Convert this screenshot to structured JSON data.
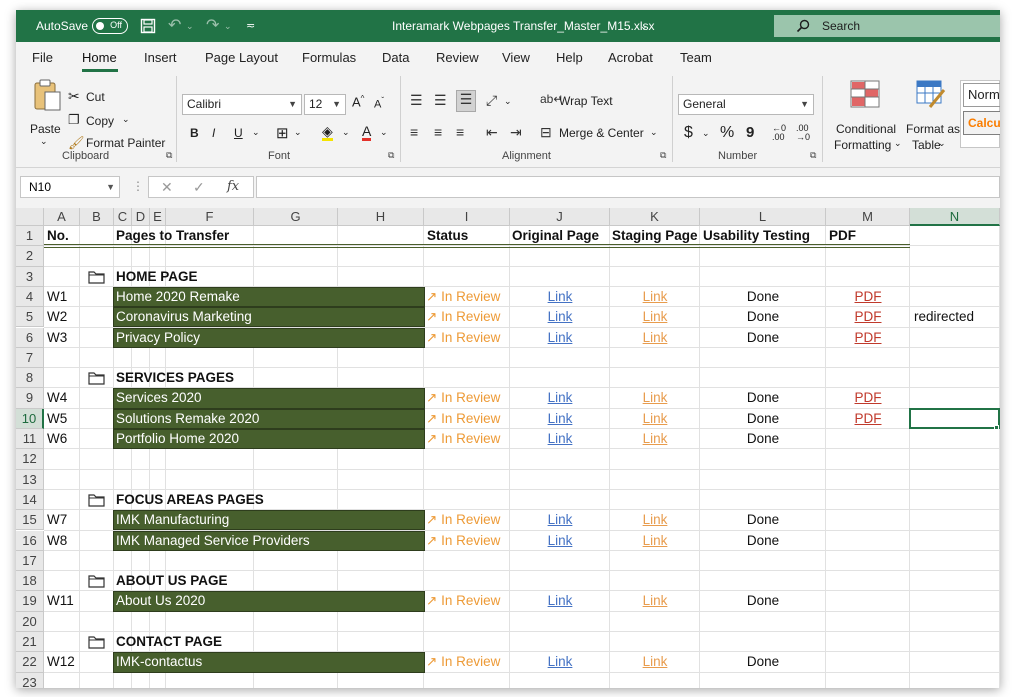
{
  "titlebar": {
    "autosave_label": "AutoSave",
    "autosave_state": "Off",
    "filename": "Interamark Webpages Transfer_Master_M15.xlsx",
    "search_label": "Search"
  },
  "menu": [
    "File",
    "Home",
    "Insert",
    "Page Layout",
    "Formulas",
    "Data",
    "Review",
    "View",
    "Help",
    "Acrobat",
    "Team"
  ],
  "ribbon": {
    "paste": "Paste",
    "cut": "Cut",
    "copy": "Copy",
    "format_painter": "Format Painter",
    "clipboard_group": "Clipboard",
    "font_name": "Calibri",
    "font_size": "12",
    "bold": "B",
    "italic": "I",
    "underline": "U",
    "font_group": "Font",
    "wrap_text": "Wrap Text",
    "merge_center": "Merge & Center",
    "alignment_group": "Alignment",
    "number_format": "General",
    "dollar": "$",
    "percent": "%",
    "comma": "9",
    "number_group": "Number",
    "conditional_formatting_1": "Conditional",
    "conditional_formatting_2": "Formatting",
    "format_as_table_1": "Format as",
    "format_as_table_2": "Table",
    "style_normal": "Norm",
    "style_calc": "Calcu"
  },
  "formula_bar": {
    "name_box": "N10",
    "fx": "fx"
  },
  "columns": [
    "A",
    "B",
    "C",
    "D",
    "E",
    "F",
    "G",
    "H",
    "I",
    "J",
    "K",
    "L",
    "M",
    "N"
  ],
  "selected_column": "N",
  "selected_row": "10",
  "headers": {
    "no": "No.",
    "pages": "Pages to Transfer",
    "status": "Status",
    "original": "Original Page",
    "staging": "Staging Page",
    "usability": "Usability Testing",
    "pdf": "PDF"
  },
  "rows": [
    {
      "row": "1"
    },
    {
      "row": "2"
    },
    {
      "row": "3",
      "section": "HOME PAGE"
    },
    {
      "row": "4",
      "no": "W1",
      "page": "Home 2020 Remake",
      "status": "In Review",
      "original": "Link",
      "staging": "Link",
      "usability": "Done",
      "pdf": "PDF"
    },
    {
      "row": "5",
      "no": "W2",
      "page": "Coronavirus Marketing",
      "status": "In Review",
      "original": "Link",
      "staging": "Link",
      "usability": "Done",
      "pdf": "PDF",
      "note": "redirected"
    },
    {
      "row": "6",
      "no": "W3",
      "page": "Privacy Policy",
      "status": "In Review",
      "original": "Link",
      "staging": "Link",
      "usability": "Done",
      "pdf": "PDF"
    },
    {
      "row": "7"
    },
    {
      "row": "8",
      "section": "SERVICES PAGES"
    },
    {
      "row": "9",
      "no": "W4",
      "page": "Services 2020",
      "status": "In Review",
      "original": "Link",
      "staging": "Link",
      "usability": "Done",
      "pdf": "PDF"
    },
    {
      "row": "10",
      "no": "W5",
      "page": "Solutions Remake 2020",
      "status": "In Review",
      "original": "Link",
      "staging": "Link",
      "usability": "Done",
      "pdf": "PDF"
    },
    {
      "row": "11",
      "no": "W6",
      "page": "Portfolio Home 2020",
      "status": "In Review",
      "original": "Link",
      "staging": "Link",
      "usability": "Done"
    },
    {
      "row": "12"
    },
    {
      "row": "13"
    },
    {
      "row": "14",
      "section": "FOCUS AREAS PAGES"
    },
    {
      "row": "15",
      "no": "W7",
      "page": "IMK Manufacturing",
      "status": "In Review",
      "original": "Link",
      "staging": "Link",
      "usability": "Done"
    },
    {
      "row": "16",
      "no": "W8",
      "page": "IMK Managed Service Providers",
      "status": "In Review",
      "original": "Link",
      "staging": "Link",
      "usability": "Done"
    },
    {
      "row": "17"
    },
    {
      "row": "18",
      "section": "ABOUT US PAGE"
    },
    {
      "row": "19",
      "no": "W11",
      "page": "About Us 2020",
      "status": "In Review",
      "original": "Link",
      "staging": "Link",
      "usability": "Done"
    },
    {
      "row": "20"
    },
    {
      "row": "21",
      "section": "CONTACT  PAGE"
    },
    {
      "row": "22",
      "no": "W12",
      "page": "IMK-contactus",
      "status": "In Review",
      "original": "Link",
      "staging": "Link",
      "usability": "Done"
    },
    {
      "row": "23"
    }
  ]
}
